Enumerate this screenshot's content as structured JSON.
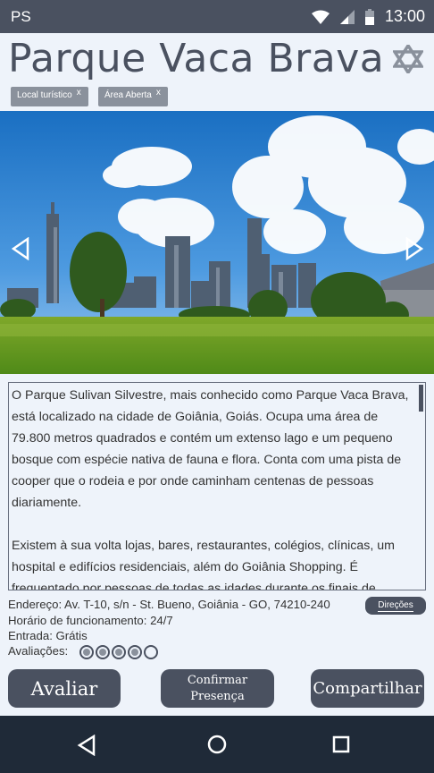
{
  "status_bar": {
    "carrier": "PS",
    "time": "13:00"
  },
  "page": {
    "title": "Parque Vaca Brava"
  },
  "tags": [
    {
      "label": "Local turístico",
      "remove": "x"
    },
    {
      "label": "Área Aberta",
      "remove": "x"
    }
  ],
  "description": {
    "paragraphs": [
      "O Parque Sulivan Silvestre, mais conhecido como Parque Vaca Brava, está localizado na cidade de Goiânia, Goiás. Ocupa uma área de 79.800 metros quadrados e contém um extenso lago e um pequeno bosque com espécie nativa de fauna e flora. Conta com uma pista de cooper que o rodeia e por onde caminham centenas de pessoas diariamente.",
      "Existem à sua volta lojas, bares, restaurantes, colégios, clínicas, um hospital e edifícios residenciais, além do Goiânia Shopping. É frequentado por pessoas de todas as idades durante os finais de semana."
    ]
  },
  "info": {
    "address": "Endereço: Av. T-10, s/n - St. Bueno, Goiânia - GO, 74210-240",
    "hours": "Horário de funcionamento: 24/7",
    "entry": "Entrada: Grátis",
    "ratings_label": "Avaliações:",
    "rating_value": 4,
    "rating_max": 5
  },
  "buttons": {
    "directions": "Direções",
    "rate": "Avaliar",
    "confirm_line1": "Confirmar",
    "confirm_line2": "Presença",
    "share": "Compartilhar"
  },
  "colors": {
    "primary": "#4a5160",
    "tag": "#8a919c",
    "background": "#eef3fa",
    "navbar": "#1f2a38"
  },
  "icons": [
    "wifi-icon",
    "signal-icon",
    "battery-icon",
    "star-of-david-icon",
    "prev-arrow-icon",
    "next-arrow-icon",
    "back-icon",
    "home-icon",
    "recents-icon"
  ]
}
